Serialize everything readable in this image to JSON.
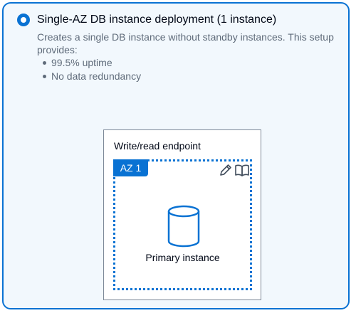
{
  "option": {
    "title": "Single-AZ DB instance deployment (1 instance)",
    "description": "Creates a single DB instance without standby instances. This setup provides:",
    "bullets": [
      "99.5% uptime",
      "No data redundancy"
    ],
    "selected": true
  },
  "diagram": {
    "endpoint_label": "Write/read endpoint",
    "az_label": "AZ 1",
    "instance_label": "Primary instance"
  },
  "icons": {
    "radio": "radio-selected-icon",
    "edit": "pencil-icon",
    "docs": "book-icon",
    "database": "database-cylinder-icon"
  },
  "colors": {
    "accent": "#0972d3",
    "card_background": "#f2f8fd",
    "text_primary": "#000716",
    "text_secondary": "#5f6b7a",
    "diagram_border": "#7d8998"
  }
}
